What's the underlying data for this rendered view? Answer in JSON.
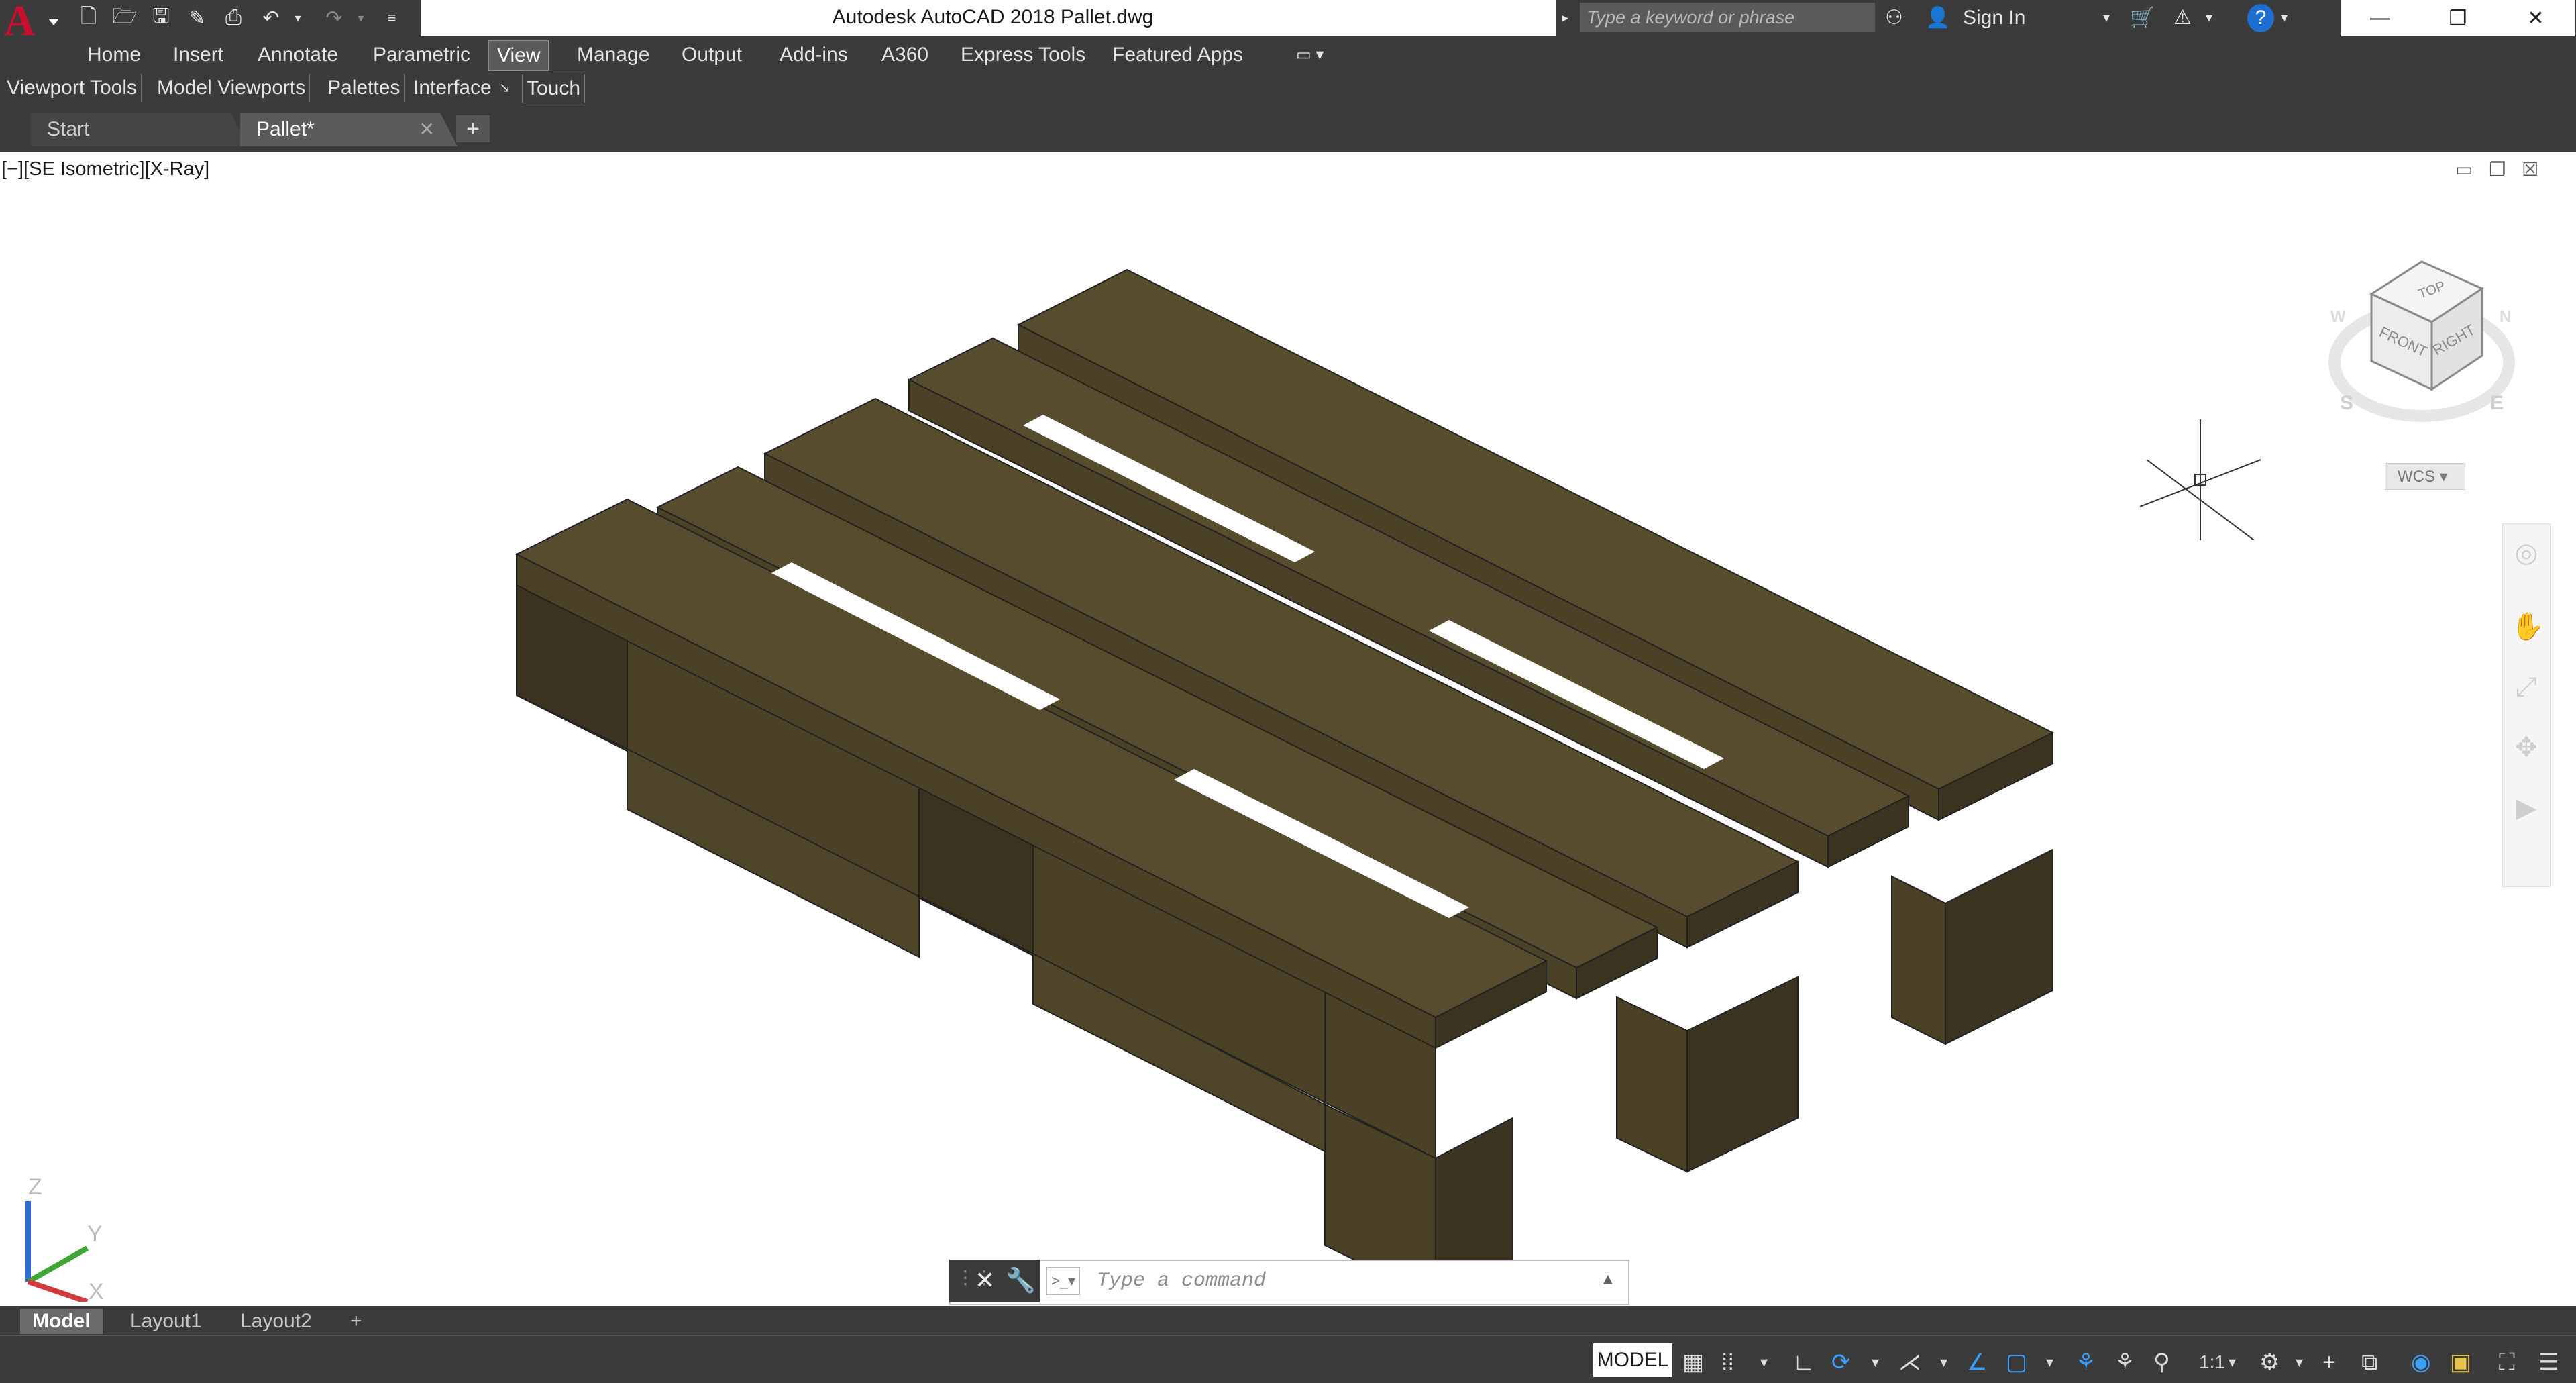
{
  "app": {
    "title": "Autodesk AutoCAD 2018    Pallet.dwg",
    "logo_letter": "A"
  },
  "quick_access": {
    "icons": [
      "new-file-icon",
      "open-icon",
      "save-icon",
      "save-as-icon",
      "print-icon",
      "undo-icon",
      "redo-icon",
      "customize-icon"
    ]
  },
  "search": {
    "placeholder": "Type a keyword or phrase",
    "sign_in": "Sign In"
  },
  "ribbon_tabs": [
    {
      "label": "Home"
    },
    {
      "label": "Insert"
    },
    {
      "label": "Annotate"
    },
    {
      "label": "Parametric"
    },
    {
      "label": "View",
      "active": true
    },
    {
      "label": "Manage"
    },
    {
      "label": "Output"
    },
    {
      "label": "Add-ins"
    },
    {
      "label": "A360"
    },
    {
      "label": "Express Tools"
    },
    {
      "label": "Featured Apps"
    }
  ],
  "panels": [
    {
      "label": "Viewport Tools"
    },
    {
      "label": "Model Viewports"
    },
    {
      "label": "Palettes"
    },
    {
      "label": "Interface"
    },
    {
      "label": "Touch"
    }
  ],
  "file_tabs": [
    {
      "label": "Start"
    },
    {
      "label": "Pallet*",
      "active": true
    }
  ],
  "viewport": {
    "label": "[−][SE Isometric][X-Ray]",
    "viewcube_faces": {
      "top": "TOP",
      "front": "FRONT",
      "right": "RIGHT"
    },
    "compass": {
      "s": "S",
      "e": "E",
      "w": "W",
      "n": "N"
    },
    "wcs": "WCS",
    "ucs": {
      "x": "X",
      "y": "Y",
      "z": "Z"
    }
  },
  "command": {
    "placeholder": "Type a command"
  },
  "layout_tabs": [
    {
      "label": "Model",
      "active": true
    },
    {
      "label": "Layout1"
    },
    {
      "label": "Layout2"
    }
  ],
  "status": {
    "model": "MODEL",
    "scale": "1:1"
  },
  "colors": {
    "wood_top": "#574d2e",
    "wood_side": "#4a4126",
    "wood_dark": "#3c3420",
    "ui_dark": "#3b3b3b",
    "accent_blue": "#3aa0ff"
  }
}
